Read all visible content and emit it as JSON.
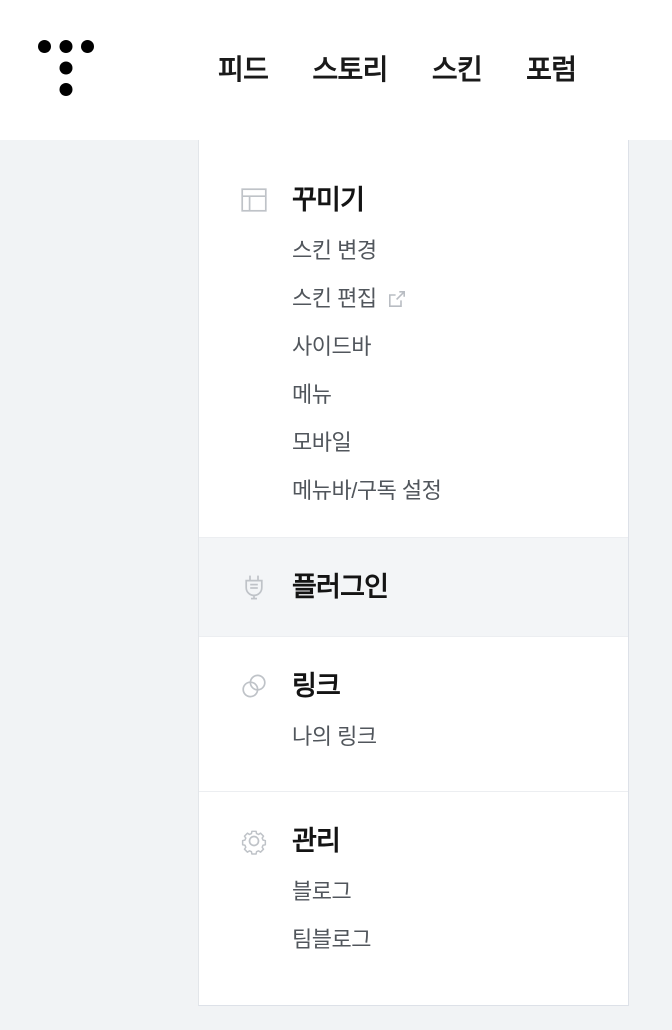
{
  "header": {
    "logo_icon": "tistory-dots-logo",
    "nav": [
      {
        "label": "피드"
      },
      {
        "label": "스토리"
      },
      {
        "label": "스킨"
      },
      {
        "label": "포럼"
      }
    ]
  },
  "panel": {
    "sections": [
      {
        "id": "decorate",
        "icon": "layout-icon",
        "title": "꾸미기",
        "highlighted": false,
        "items": [
          {
            "label": "스킨 변경",
            "external": false
          },
          {
            "label": "스킨 편집",
            "external": true,
            "external_icon": "external-link-icon"
          },
          {
            "label": "사이드바",
            "external": false
          },
          {
            "label": "메뉴",
            "external": false
          },
          {
            "label": "모바일",
            "external": false
          },
          {
            "label": "메뉴바/구독 설정",
            "external": false
          }
        ]
      },
      {
        "id": "plugin",
        "icon": "plug-icon",
        "title": "플러그인",
        "highlighted": true,
        "items": []
      },
      {
        "id": "link",
        "icon": "link-circles-icon",
        "title": "링크",
        "highlighted": false,
        "items": [
          {
            "label": "나의 링크",
            "external": false
          }
        ]
      },
      {
        "id": "manage",
        "icon": "gear-icon",
        "title": "관리",
        "highlighted": false,
        "items": [
          {
            "label": "블로그",
            "external": false
          },
          {
            "label": "팀블로그",
            "external": false
          }
        ]
      }
    ]
  },
  "colors": {
    "page_background": "#f1f3f5",
    "panel_background": "#ffffff",
    "highlight_background": "#f3f5f7",
    "title_text": "#141414",
    "sub_text": "#51565c",
    "icon_gray": "#bfc3c8",
    "divider": "#eceef1"
  }
}
